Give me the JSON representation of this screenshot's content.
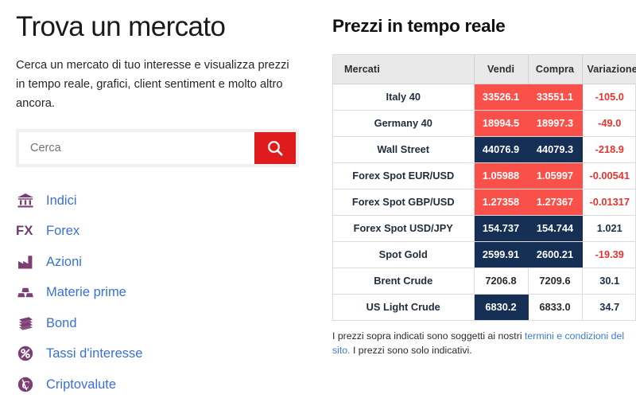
{
  "left": {
    "title": "Trova un mercato",
    "intro": "Cerca un mercato di tuo interesse e visualizza prezzi in tempo reale, grafici, client sentiment e molto altro ancora.",
    "search": {
      "placeholder": "Cerca",
      "value": "",
      "button_icon": "search-icon"
    },
    "categories": [
      {
        "label": "Indici",
        "icon": "bank-icon"
      },
      {
        "label": "Forex",
        "icon": "fx-icon"
      },
      {
        "label": "Azioni",
        "icon": "factory-icon"
      },
      {
        "label": "Materie prime",
        "icon": "gold-bars-icon"
      },
      {
        "label": "Bond",
        "icon": "banknotes-icon"
      },
      {
        "label": "Tassi d'interesse",
        "icon": "percent-circle-icon"
      },
      {
        "label": "Criptovalute",
        "icon": "crypto-coin-icon"
      }
    ]
  },
  "right": {
    "title": "Prezzi in tempo reale",
    "columns": [
      "Mercati",
      "Vendi",
      "Compra",
      "Variazione"
    ],
    "rows": [
      {
        "name": "Italy 40",
        "sell": "33526.1",
        "buy": "33551.1",
        "change": "-105.0",
        "sell_state": "hl-red",
        "buy_state": "hl-red",
        "change_dir": "neg"
      },
      {
        "name": "Germany 40",
        "sell": "18994.5",
        "buy": "18997.3",
        "change": "-49.0",
        "sell_state": "hl-red",
        "buy_state": "hl-red",
        "change_dir": "neg"
      },
      {
        "name": "Wall Street",
        "sell": "44076.9",
        "buy": "44079.3",
        "change": "-218.9",
        "sell_state": "hl-navy",
        "buy_state": "hl-navy",
        "change_dir": "neg"
      },
      {
        "name": "Forex Spot EUR/USD",
        "sell": "1.05988",
        "buy": "1.05997",
        "change": "-0.00541",
        "sell_state": "hl-red",
        "buy_state": "hl-red",
        "change_dir": "neg"
      },
      {
        "name": "Forex Spot GBP/USD",
        "sell": "1.27358",
        "buy": "1.27367",
        "change": "-0.01317",
        "sell_state": "hl-red",
        "buy_state": "hl-red",
        "change_dir": "neg"
      },
      {
        "name": "Forex Spot USD/JPY",
        "sell": "154.737",
        "buy": "154.744",
        "change": "1.021",
        "sell_state": "hl-navy",
        "buy_state": "hl-navy",
        "change_dir": "pos"
      },
      {
        "name": "Spot Gold",
        "sell": "2599.91",
        "buy": "2600.21",
        "change": "-19.39",
        "sell_state": "hl-navy",
        "buy_state": "hl-navy",
        "change_dir": "neg"
      },
      {
        "name": "Brent Crude",
        "sell": "7206.8",
        "buy": "7209.6",
        "change": "30.1",
        "sell_state": "plain",
        "buy_state": "plain",
        "change_dir": "pos"
      },
      {
        "name": "US Light Crude",
        "sell": "6830.2",
        "buy": "6833.0",
        "change": "34.7",
        "sell_state": "hl-navy",
        "buy_state": "plain",
        "change_dir": "pos"
      }
    ],
    "disclaimer": {
      "before": "I prezzi sopra indicati sono soggetti ai nostri ",
      "link": "termini e condizioni del sito.",
      "after": " I prezzi sono solo indicativi."
    }
  },
  "colors": {
    "accent_red": "#e01b1b",
    "cell_red": "#f9504a",
    "cell_navy": "#152f55",
    "link_blue": "#3a6fd8",
    "icon_purple": "#7b3f73",
    "change_negative": "#e8342e",
    "change_positive": "#17304d"
  }
}
